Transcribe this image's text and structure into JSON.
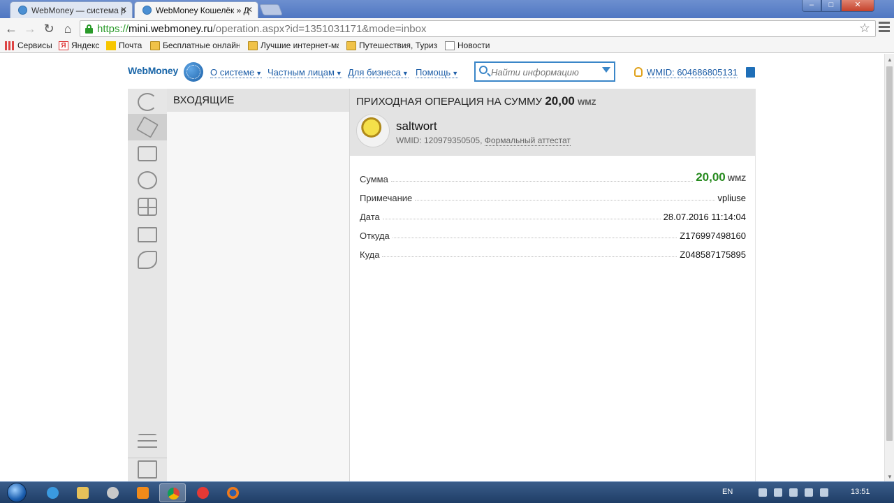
{
  "browser": {
    "tabs": [
      {
        "label": "WebMoney — система р"
      },
      {
        "label": "WebMoney Кошелёк » Д"
      }
    ],
    "tab_close_glyph": "✕",
    "window_controls": {
      "minimize": "–",
      "maximize": "□",
      "close": "✕"
    },
    "nav": {
      "back": "←",
      "forward": "→",
      "reload": "↻",
      "home": "⌂"
    },
    "url": {
      "scheme": "https://",
      "host": "mini.webmoney.ru",
      "path": "/operation.aspx?id=1351031171&mode=inbox"
    },
    "star": "☆",
    "bookmarks": [
      {
        "label": "Сервисы",
        "icon": "apps-icon"
      },
      {
        "label": "Яндекс",
        "icon": "yandex-icon"
      },
      {
        "label": "Почта",
        "icon": "mail-icon"
      },
      {
        "label": "Бесплатные онлайн и",
        "icon": "folder-icon"
      },
      {
        "label": "Лучшие интернет-ма",
        "icon": "folder-icon"
      },
      {
        "label": "Путешествия, Туризм",
        "icon": "folder-icon"
      },
      {
        "label": "Новости",
        "icon": "page-icon"
      }
    ]
  },
  "header": {
    "logo": "WebMoney",
    "nav": [
      {
        "label": "О системе"
      },
      {
        "label": "Частным лицам"
      },
      {
        "label": "Для бизнеса"
      },
      {
        "label": "Помощь"
      }
    ],
    "caret": "▼",
    "search_placeholder": "Найти информацию",
    "wmid_label": "WMID: 604686805131"
  },
  "sidebar": {
    "items": [
      {
        "name": "refresh-icon"
      },
      {
        "name": "box-icon",
        "active": true
      },
      {
        "name": "wallet-icon"
      },
      {
        "name": "contacts-icon"
      },
      {
        "name": "services-icon"
      },
      {
        "name": "shopping-bag-icon"
      },
      {
        "name": "hand-icon"
      }
    ],
    "bottom": [
      {
        "name": "settings-sliders-icon"
      },
      {
        "name": "logout-icon"
      }
    ]
  },
  "inbox": {
    "title": "ВХОДЯЩИЕ"
  },
  "operation": {
    "title_prefix": "ПРИХОДНАЯ ОПЕРАЦИЯ НА СУММУ",
    "amount": "20,00",
    "currency": "WMZ",
    "peer_name": "saltwort",
    "peer_wmid": "WMID: 120979350505,",
    "peer_attestat": "Формальный аттестат",
    "rows": [
      {
        "key": "Сумма",
        "value": "20,00",
        "currency": "WMZ"
      },
      {
        "key": "Примечание",
        "value": "vpliuse"
      },
      {
        "key": "Дата",
        "value": "28.07.2016 11:14:04"
      },
      {
        "key": "Откуда",
        "value": "Z176997498160"
      },
      {
        "key": "Куда",
        "value": "Z048587175895"
      }
    ]
  },
  "taskbar": {
    "language": "EN",
    "time": "13:51"
  },
  "colors": {
    "accent": "#1f5fa8",
    "amount_green": "#268a1e",
    "panel_gray": "#e3e3e3"
  }
}
